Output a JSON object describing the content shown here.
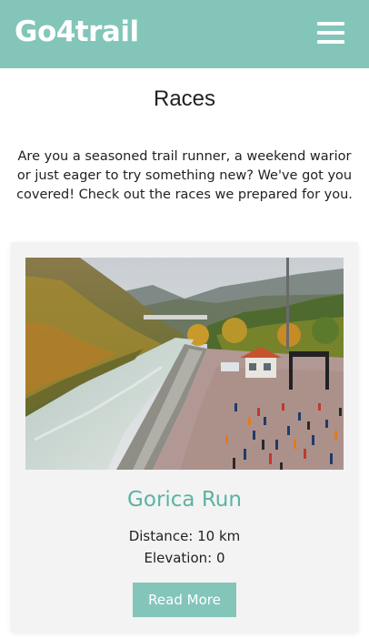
{
  "header": {
    "logo": "Go4trail",
    "menu_icon": "hamburger-menu-icon",
    "background_color": "#83c6b9"
  },
  "main": {
    "title": "Races",
    "intro": "Are you a seasoned trail runner, a weekend warior or just eager to try something new? We've got you covered! Check out the races we prepared for you."
  },
  "races": [
    {
      "name": "Gorica Run",
      "distance": "Distance: 10 km",
      "elevation": "Elevation: 0",
      "button_label": "Read More",
      "accent_color": "#5cb3a3"
    }
  ]
}
